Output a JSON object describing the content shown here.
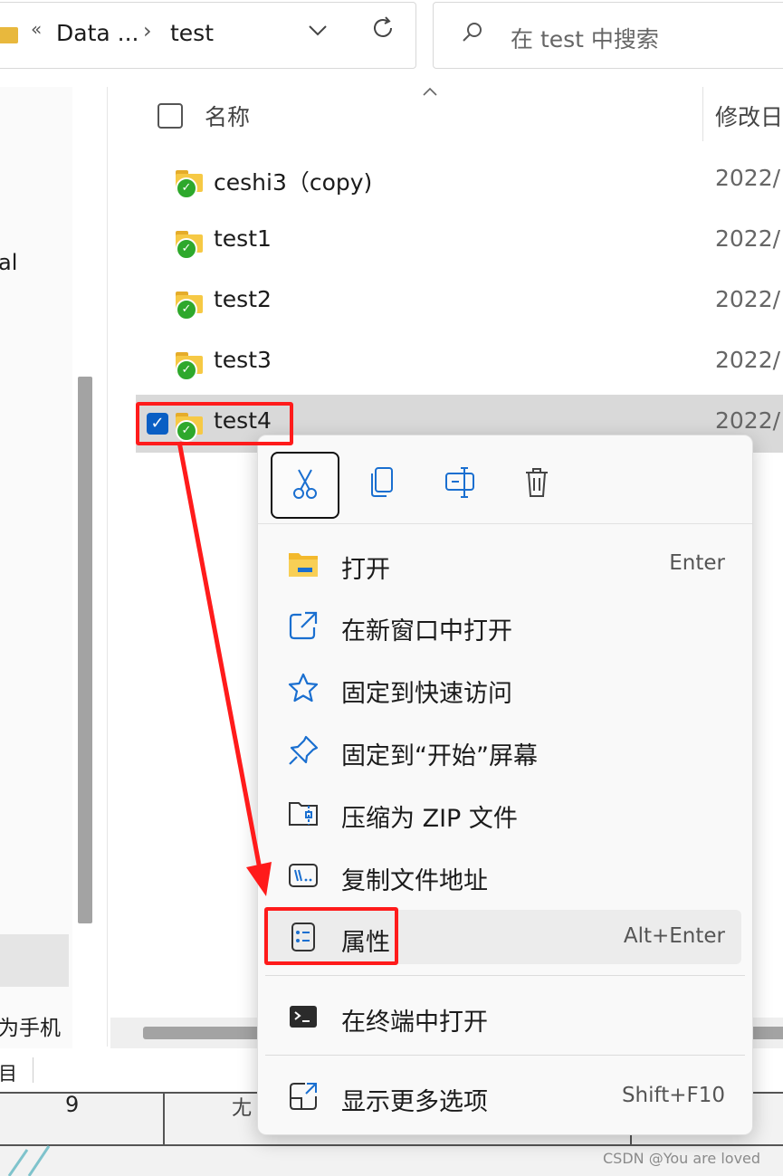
{
  "address_bar": {
    "overflow_symbol": "«",
    "segments": [
      "Data ...",
      "test"
    ],
    "separator": "›",
    "dropdown_icon": "chevron-down-icon",
    "refresh_icon": "refresh-icon"
  },
  "search": {
    "placeholder": "在 test 中搜索",
    "icon": "search-icon"
  },
  "nav_pane": {
    "partial_item": "al",
    "phone_item": "为手机",
    "status_text": "目"
  },
  "columns": {
    "name": "名称",
    "modified": "修改日"
  },
  "files": [
    {
      "name": "ceshi3（copy)",
      "date": "2022/",
      "selected": false
    },
    {
      "name": "test1",
      "date": "2022/",
      "selected": false
    },
    {
      "name": "test2",
      "date": "2022/",
      "selected": false
    },
    {
      "name": "test3",
      "date": "2022/",
      "selected": false
    },
    {
      "name": "test4",
      "date": "2022/",
      "selected": true
    }
  ],
  "context_menu": {
    "quick_actions": [
      {
        "name": "cut",
        "icon": "scissors-icon"
      },
      {
        "name": "copy",
        "icon": "copy-icon"
      },
      {
        "name": "rename",
        "icon": "rename-icon"
      },
      {
        "name": "delete",
        "icon": "trash-icon"
      }
    ],
    "items": [
      {
        "label": "打开",
        "shortcut": "Enter",
        "icon": "folder-open-icon"
      },
      {
        "label": "在新窗口中打开",
        "shortcut": "",
        "icon": "open-new-window-icon"
      },
      {
        "label": "固定到快速访问",
        "shortcut": "",
        "icon": "star-icon"
      },
      {
        "label": "固定到“开始”屏幕",
        "shortcut": "",
        "icon": "pin-icon"
      },
      {
        "label": "压缩为 ZIP 文件",
        "shortcut": "",
        "icon": "zip-folder-icon"
      },
      {
        "label": "复制文件地址",
        "shortcut": "",
        "icon": "copy-path-icon"
      },
      {
        "label": "属性",
        "shortcut": "Alt+Enter",
        "icon": "properties-icon"
      },
      {
        "label": "在终端中打开",
        "shortcut": "",
        "icon": "terminal-icon"
      },
      {
        "label": "显示更多选项",
        "shortcut": "Shift+F10",
        "icon": "more-options-icon"
      }
    ]
  },
  "background_sheet": {
    "cell_a": "9",
    "cell_b": "尢"
  },
  "watermark": "CSDN @You are loved",
  "colors": {
    "annotation": "#ff1b1b",
    "folder": "#f6c945",
    "sync_check": "#2ea82c",
    "checkbox": "#0a5fc4",
    "icon_blue": "#1a6fd0"
  }
}
